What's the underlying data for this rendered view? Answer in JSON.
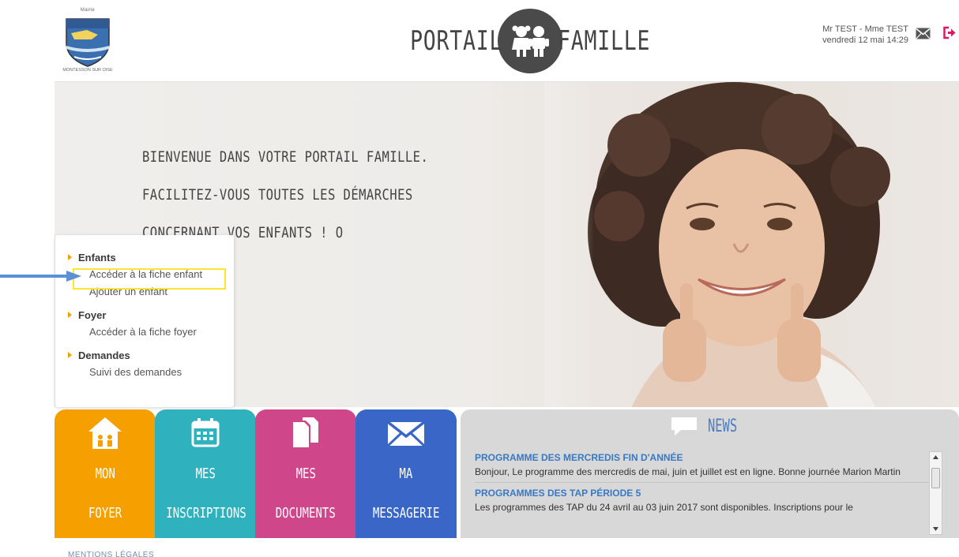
{
  "header": {
    "logo_caption_top": "Mairie",
    "logo_caption_bottom": "MONTESSON SUR OISE",
    "brand_left": "PORTAIL",
    "brand_right": "FAMILLE",
    "user_name": "Mr TEST - Mme TEST",
    "date_time": "vendredi 12 mai 14:29",
    "icons": {
      "mail": "envelope-icon",
      "logout": "logout-icon"
    }
  },
  "hero": {
    "line1": "BIENVENUE DANS VOTRE PORTAIL FAMILLE.",
    "line2": "FACILITEZ-VOUS TOUTES LES DÉMARCHES",
    "line3": "CONCERNANT VOS ENFANTS ! O"
  },
  "menu": {
    "sections": [
      {
        "title": "Enfants",
        "links": [
          "Accéder à la fiche enfant",
          "Ajouter un enfant"
        ]
      },
      {
        "title": "Foyer",
        "links": [
          "Accéder à la fiche foyer"
        ]
      },
      {
        "title": "Demandes",
        "links": [
          "Suivi des demandes"
        ]
      }
    ],
    "highlighted_link": "Accéder à la fiche enfant"
  },
  "tiles": [
    {
      "line1": "MON",
      "line2": "FOYER",
      "icon": "house-icon",
      "color": "#f5a000"
    },
    {
      "line1": "MES",
      "line2": "INSCRIPTIONS",
      "icon": "calendar-icon",
      "color": "#2fb2bd"
    },
    {
      "line1": "MES",
      "line2": "DOCUMENTS",
      "icon": "documents-icon",
      "color": "#d0468a"
    },
    {
      "line1": "MA",
      "line2": "MESSAGERIE",
      "icon": "envelope-icon",
      "color": "#3a67c7"
    }
  ],
  "news": {
    "title": "NEWS",
    "items": [
      {
        "title": "PROGRAMME DES MERCREDIS FIN D'ANNÉE",
        "text": "Bonjour, Le programme des mercredis de mai, juin et juillet est en ligne. Bonne journée Marion Martin"
      },
      {
        "title": "PROGRAMMES DES TAP PÉRIODE 5",
        "text": "Les programmes des TAP du 24 avril au 03 juin 2017 sont disponibles. Inscriptions pour le"
      }
    ]
  },
  "footer": {
    "legal": "MENTIONS LÉGALES"
  },
  "colors": {
    "accent_orange": "#f5a000",
    "news_blue": "#3a78c2",
    "highlight_yellow": "#ffe62e"
  }
}
